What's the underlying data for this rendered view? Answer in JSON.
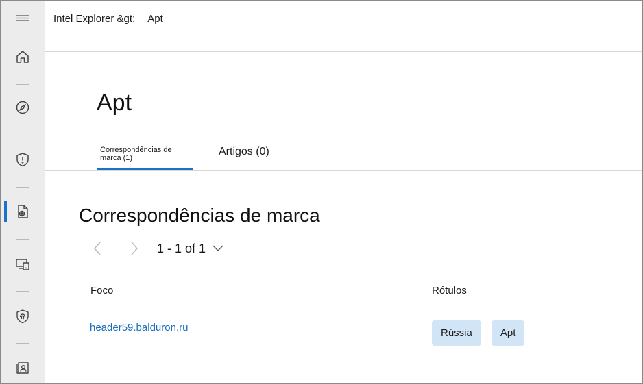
{
  "rail": {
    "items": [
      {
        "icon": "hamburger-menu-icon"
      },
      {
        "icon": "home-icon"
      },
      {
        "icon": "compass-icon"
      },
      {
        "icon": "shield-alert-icon"
      },
      {
        "icon": "intel-document-icon"
      },
      {
        "icon": "devices-icon"
      },
      {
        "icon": "fingerprint-shield-icon"
      },
      {
        "icon": "contact-card-icon"
      }
    ],
    "accent_color": "#1a73c8"
  },
  "breadcrumb": {
    "root": "Intel Explorer &gt;",
    "current": "Apt"
  },
  "page": {
    "title": "Apt"
  },
  "tabs": [
    {
      "label": "Correspondências de marca (1)",
      "active": true
    },
    {
      "label": "Artigos (0)",
      "active": false
    }
  ],
  "section": {
    "title": "Correspondências de marca"
  },
  "pager": {
    "count": "1 - 1 of 1"
  },
  "table": {
    "columns": [
      "Foco",
      "Rótulos"
    ],
    "rows": [
      {
        "focus": "header59.balduron.ru",
        "labels": [
          "Rússia",
          "Apt"
        ]
      }
    ]
  },
  "colors": {
    "link": "#1a6fbf",
    "tag_bg": "#d1e5f7",
    "rail_bg": "#ececec"
  }
}
